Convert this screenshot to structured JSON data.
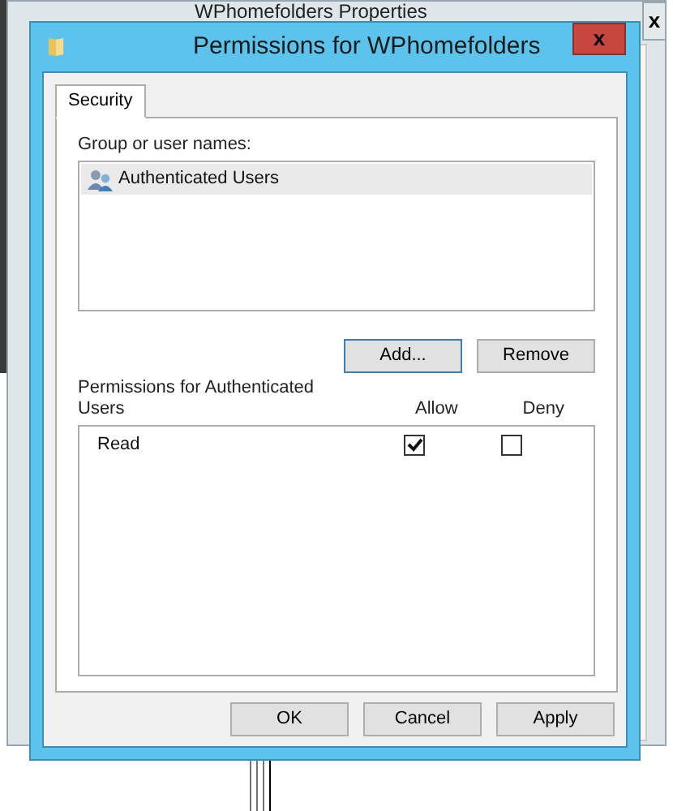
{
  "background_window": {
    "title": "WPhomefolders Properties",
    "close": "x"
  },
  "window": {
    "title": "Permissions for WPhomefolders",
    "close": "x"
  },
  "tabs": [
    {
      "label": "Security",
      "selected": true
    }
  ],
  "group_label": "Group or user names:",
  "users": [
    {
      "name": "Authenticated Users",
      "selected": true
    }
  ],
  "user_buttons": [
    "Add...",
    "Remove"
  ],
  "permissions": {
    "label": "Permissions for Authenticated Users",
    "columns": [
      "Allow",
      "Deny"
    ],
    "rows": [
      {
        "name": "Read",
        "allow": true,
        "deny": false
      }
    ]
  },
  "buttons": [
    "OK",
    "Cancel",
    "Apply"
  ]
}
